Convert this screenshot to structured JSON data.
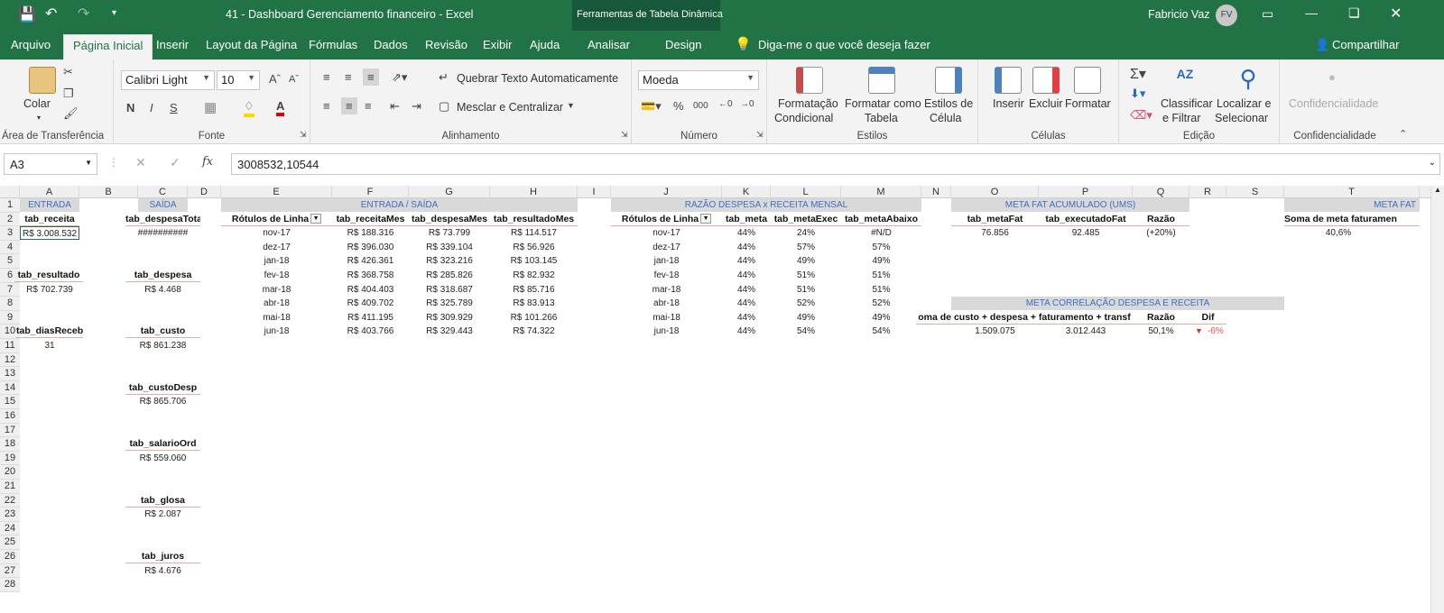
{
  "title": {
    "doc": "41 - Dashboard Gerenciamento financeiro  -  Excel",
    "context_tools": "Ferramentas de Tabela Dinâmica",
    "user": "Fabricio Vaz",
    "avatar": "FV"
  },
  "tabs": [
    "Arquivo",
    "Página Inicial",
    "Inserir",
    "Layout da Página",
    "Fórmulas",
    "Dados",
    "Revisão",
    "Exibir",
    "Ajuda",
    "Analisar",
    "Design"
  ],
  "tell_me": "Diga-me o que você deseja fazer",
  "share": "Compartilhar",
  "ribbon": {
    "clipboard": {
      "paste": "Colar",
      "label": "Área de Transferência"
    },
    "font": {
      "name": "Calibri Light",
      "size": "10",
      "bold": "N",
      "italic": "I",
      "underline": "S",
      "label": "Fonte"
    },
    "align": {
      "wrap": "Quebrar Texto Automaticamente",
      "merge": "Mesclar e Centralizar",
      "label": "Alinhamento"
    },
    "number": {
      "format": "Moeda",
      "percent": "%",
      "thousands": "000",
      "label": "Número"
    },
    "styles": {
      "cond1": "Formatação",
      "cond2": "Condicional",
      "table1": "Formatar como",
      "table2": "Tabela",
      "cell1": "Estilos de",
      "cell2": "Célula",
      "label": "Estilos"
    },
    "cells": {
      "insert": "Inserir",
      "delete": "Excluir",
      "format": "Formatar",
      "label": "Células"
    },
    "edit": {
      "sort1": "Classificar",
      "sort2": "e Filtrar",
      "find1": "Localizar e",
      "find2": "Selecionar",
      "label": "Edição"
    },
    "conf": {
      "btn": "Confidencialidade",
      "label": "Confidencialidade"
    }
  },
  "formula_bar": {
    "name_box": "A3",
    "fx": "fx",
    "value": "3008532,10544"
  },
  "columns": [
    "A",
    "B",
    "C",
    "D",
    "E",
    "F",
    "G",
    "H",
    "I",
    "J",
    "K",
    "L",
    "M",
    "N",
    "O",
    "P",
    "Q",
    "R",
    "S",
    "T"
  ],
  "rows": [
    "1",
    "2",
    "3",
    "4",
    "5",
    "6",
    "7",
    "8",
    "9",
    "10",
    "11",
    "12",
    "13",
    "14",
    "15",
    "16",
    "17",
    "18",
    "19",
    "20",
    "21",
    "22",
    "23",
    "24",
    "25",
    "26",
    "27",
    "28"
  ],
  "entrada": {
    "header": "ENTRADA",
    "receita_label": "tab_receita",
    "receita": "R$ 3.008.532",
    "resultado_label": "tab_resultado",
    "resultado": "R$ 702.739",
    "dias_label": "tab_diasReceb",
    "dias": "31"
  },
  "saida": {
    "header": "SAÍDA",
    "items": [
      {
        "label": "tab_despesaTotal",
        "value": "##########"
      },
      {
        "label": "tab_despesa",
        "value": "R$ 4.468"
      },
      {
        "label": "tab_custo",
        "value": "R$ 861.238"
      },
      {
        "label": "tab_custoDesp",
        "value": "R$ 865.706"
      },
      {
        "label": "tab_salarioOrd",
        "value": "R$ 559.060"
      },
      {
        "label": "tab_glosa",
        "value": "R$ 2.087"
      },
      {
        "label": "tab_juros",
        "value": "R$ 4.676"
      }
    ]
  },
  "es": {
    "header": "ENTRADA / SAÍDA",
    "cols": [
      "Rótulos de Linha",
      "tab_receitaMes",
      "tab_despesaMes",
      "tab_resultadoMes"
    ],
    "rows": [
      [
        "nov-17",
        "R$ 188.316",
        "R$ 73.799",
        "R$ 114.517"
      ],
      [
        "dez-17",
        "R$ 396.030",
        "R$ 339.104",
        "R$ 56.926"
      ],
      [
        "jan-18",
        "R$ 426.361",
        "R$ 323.216",
        "R$ 103.145"
      ],
      [
        "fev-18",
        "R$ 368.758",
        "R$ 285.826",
        "R$ 82.932"
      ],
      [
        "mar-18",
        "R$ 404.403",
        "R$ 318.687",
        "R$ 85.716"
      ],
      [
        "abr-18",
        "R$ 409.702",
        "R$ 325.789",
        "R$ 83.913"
      ],
      [
        "mai-18",
        "R$ 411.195",
        "R$ 309.929",
        "R$ 101.266"
      ],
      [
        "jun-18",
        "R$ 403.766",
        "R$ 329.443",
        "R$ 74.322"
      ]
    ]
  },
  "razao": {
    "header": "RAZÃO DESPESA x RECEITA MENSAL",
    "cols": [
      "Rótulos de Linha",
      "tab_meta",
      "tab_metaExec",
      "tab_metaAbaixo"
    ],
    "rows": [
      [
        "nov-17",
        "44%",
        "24%",
        "#N/D"
      ],
      [
        "dez-17",
        "44%",
        "57%",
        "57%"
      ],
      [
        "jan-18",
        "44%",
        "49%",
        "49%"
      ],
      [
        "fev-18",
        "44%",
        "51%",
        "51%"
      ],
      [
        "mar-18",
        "44%",
        "51%",
        "51%"
      ],
      [
        "abr-18",
        "44%",
        "52%",
        "52%"
      ],
      [
        "mai-18",
        "44%",
        "49%",
        "49%"
      ],
      [
        "jun-18",
        "44%",
        "54%",
        "54%"
      ]
    ]
  },
  "metafat": {
    "header": "META FAT ACUMULADO (UMS)",
    "cols": [
      "tab_metaFat",
      "tab_executadoFat",
      "Razão"
    ],
    "values": [
      "76.856",
      "92.485",
      "(+20%)"
    ]
  },
  "metacorr": {
    "header": "META CORRELAÇÃO DESPESA E RECEITA",
    "cols": [
      "oma de custo + despesa + faturamento + transf",
      "",
      "Razão",
      "Dif"
    ],
    "values": [
      "1.509.075",
      "3.012.443",
      "50,1%",
      "-6%"
    ]
  },
  "metafat2": {
    "header": "META FAT",
    "col": "Soma de meta faturamen",
    "value": "40,6%"
  }
}
